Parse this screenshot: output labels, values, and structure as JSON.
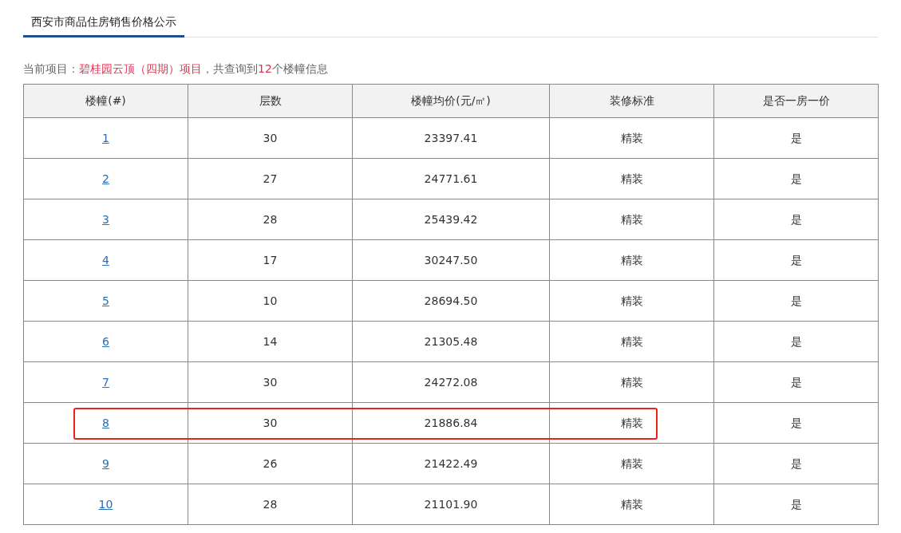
{
  "tabs": [
    {
      "label": "西安市商品住房销售价格公示",
      "selected": true
    }
  ],
  "summary": [
    {
      "text": "当前项目：",
      "highlight": false
    },
    {
      "text": "碧桂园云顶（四期）项目",
      "highlight": true
    },
    {
      "text": "，共查询到",
      "highlight": false
    },
    {
      "text": "12",
      "highlight": true
    },
    {
      "text": "个楼幢信息",
      "highlight": false
    }
  ],
  "table": {
    "columns": [
      "楼幢(#)",
      "层数",
      "楼幢均价(元/㎡)",
      "装修标准",
      "是否一房一价"
    ],
    "rows": [
      {
        "building": "1",
        "floors": "30",
        "avg_price": "23397.41",
        "decoration": "精装",
        "one_price": "是",
        "highlighted": false
      },
      {
        "building": "2",
        "floors": "27",
        "avg_price": "24771.61",
        "decoration": "精装",
        "one_price": "是",
        "highlighted": false
      },
      {
        "building": "3",
        "floors": "28",
        "avg_price": "25439.42",
        "decoration": "精装",
        "one_price": "是",
        "highlighted": false
      },
      {
        "building": "4",
        "floors": "17",
        "avg_price": "30247.50",
        "decoration": "精装",
        "one_price": "是",
        "highlighted": false
      },
      {
        "building": "5",
        "floors": "10",
        "avg_price": "28694.50",
        "decoration": "精装",
        "one_price": "是",
        "highlighted": false
      },
      {
        "building": "6",
        "floors": "14",
        "avg_price": "21305.48",
        "decoration": "精装",
        "one_price": "是",
        "highlighted": false
      },
      {
        "building": "7",
        "floors": "30",
        "avg_price": "24272.08",
        "decoration": "精装",
        "one_price": "是",
        "highlighted": false
      },
      {
        "building": "8",
        "floors": "30",
        "avg_price": "21886.84",
        "decoration": "精装",
        "one_price": "是",
        "highlighted": true
      },
      {
        "building": "9",
        "floors": "26",
        "avg_price": "21422.49",
        "decoration": "精装",
        "one_price": "是",
        "highlighted": false
      },
      {
        "building": "10",
        "floors": "28",
        "avg_price": "21101.90",
        "decoration": "精装",
        "one_price": "是",
        "highlighted": false
      }
    ]
  }
}
